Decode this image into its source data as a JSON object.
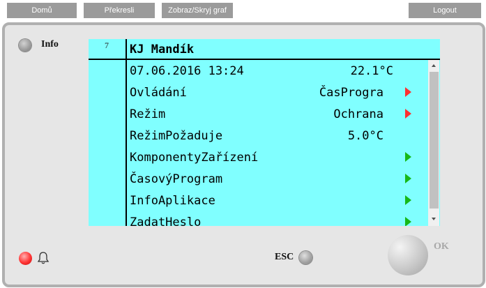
{
  "toolbar": {
    "home_label": "Domů",
    "redraw_label": "Překresli",
    "toggle_graph_label": "Zobraz/Skryj graf",
    "logout_label": "Logout"
  },
  "panel": {
    "info_label": "Info",
    "page_number": "7",
    "title": "KJ Mandík",
    "esc_label": "ESC",
    "ok_label": "OK",
    "alarm_led_color": "#ff3333"
  },
  "screen": {
    "background_color": "#80ffff",
    "datetime": "07.06.2016 13:24",
    "temperature": "22.1°C",
    "rows": [
      {
        "label": "Ovládání",
        "value": "ČasProgra",
        "arrow": "red"
      },
      {
        "label": "Režim",
        "value": "Ochrana",
        "arrow": "red"
      },
      {
        "label": "RežimPožaduje",
        "value": "5.0°C",
        "arrow": ""
      },
      {
        "label": "KomponentyZařízení",
        "value": "",
        "arrow": "green"
      },
      {
        "label": "ČasovýProgram",
        "value": "",
        "arrow": "green"
      },
      {
        "label": "InfoAplikace",
        "value": "",
        "arrow": "green"
      },
      {
        "label": "ZadatHeslo",
        "value": "",
        "arrow": "green"
      }
    ]
  },
  "icons": {
    "bell": "bell-icon",
    "info_led": "led-icon",
    "arrow_colors": {
      "red": "#ff3030",
      "green": "#17b817"
    }
  }
}
